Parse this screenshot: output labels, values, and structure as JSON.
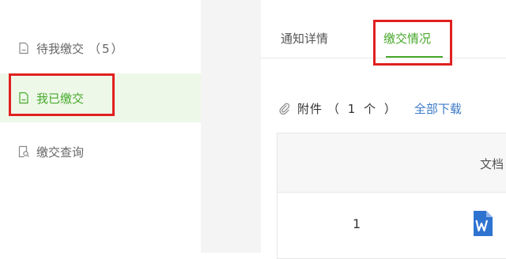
{
  "sidebar": {
    "items": [
      {
        "label": "待我缴交",
        "count": "（5）",
        "icon": "document-icon"
      },
      {
        "label": "我已缴交",
        "icon": "document-icon",
        "active": true
      },
      {
        "label": "缴交查询",
        "icon": "search-document-icon"
      }
    ]
  },
  "tabs": [
    {
      "label": "通知详情"
    },
    {
      "label": "缴交情况",
      "active": true
    }
  ],
  "attachments": {
    "label": "附件",
    "count": "（ 1 个 ）",
    "download_all": "全部下载"
  },
  "table": {
    "header_doc": "文档",
    "rows": [
      {
        "num": "1",
        "icon": "word-icon"
      }
    ]
  },
  "colors": {
    "accent": "#47a92b",
    "highlight_box": "#e02020",
    "link": "#3d7ac7"
  }
}
